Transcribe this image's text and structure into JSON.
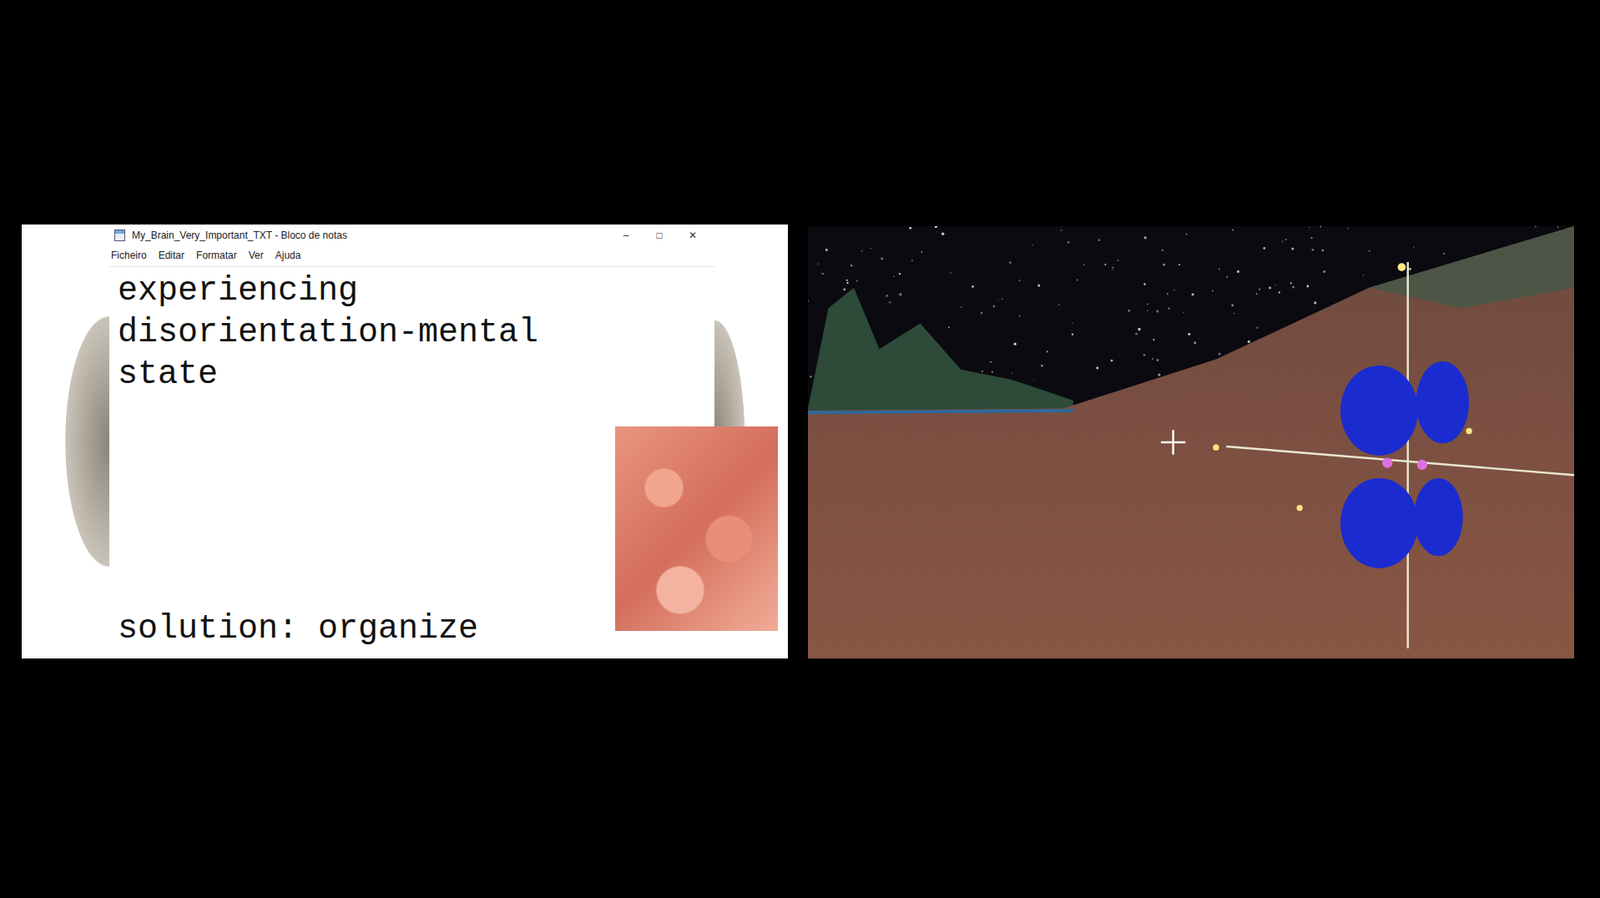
{
  "window": {
    "title": "My_Brain_Very_Important_TXT - Bloco de notas",
    "controls": [
      "–",
      "□",
      "✕"
    ]
  },
  "menu": [
    "Ficheiro",
    "Editar",
    "Formatar",
    "Ver",
    "Ajuda"
  ],
  "document": {
    "lines": [
      "experiencing",
      "disorientation-mental",
      "state"
    ],
    "solution": "solution: organize"
  }
}
